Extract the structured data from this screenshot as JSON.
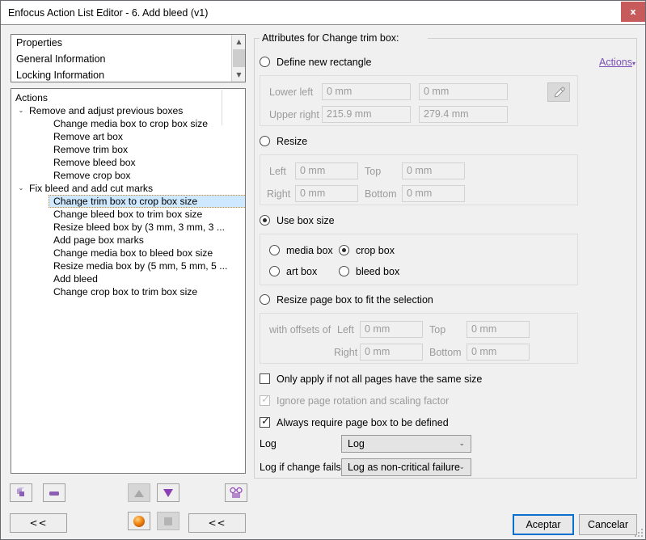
{
  "window": {
    "title": "Enfocus Action List Editor - 6. Add bleed (v1)",
    "close_label": "x"
  },
  "properties_list": {
    "items": [
      {
        "label": "Properties"
      },
      {
        "label": "General Information"
      },
      {
        "label": "Locking Information"
      }
    ]
  },
  "actions_tree": {
    "header": "Actions",
    "rows": [
      {
        "label": "Remove and adjust previous boxes",
        "type": "group",
        "expanded": true
      },
      {
        "label": "Change media box to crop box size",
        "type": "leaf"
      },
      {
        "label": "Remove art box",
        "type": "leaf"
      },
      {
        "label": "Remove trim box",
        "type": "leaf"
      },
      {
        "label": "Remove bleed box",
        "type": "leaf"
      },
      {
        "label": "Remove crop box",
        "type": "leaf"
      },
      {
        "label": "Fix bleed and add cut marks",
        "type": "group",
        "expanded": true
      },
      {
        "label": "Change trim box to crop box size",
        "type": "leaf",
        "selected": true
      },
      {
        "label": "Change bleed box to trim box size",
        "type": "leaf"
      },
      {
        "label": "Resize bleed box by (3 mm, 3 mm, 3 ...",
        "type": "leaf"
      },
      {
        "label": "Add page box marks",
        "type": "leaf"
      },
      {
        "label": "Change media box to bleed box size",
        "type": "leaf"
      },
      {
        "label": "Resize media box by (5 mm, 5 mm, 5 ...",
        "type": "leaf"
      },
      {
        "label": "Add bleed",
        "type": "leaf"
      },
      {
        "label": "Change crop box to trim box size",
        "type": "leaf"
      }
    ],
    "twisty_glyph": "⌄"
  },
  "left_toolbar": {
    "duplicate_action": "duplicate-action",
    "remove_action": "remove-action",
    "move_up": "move-up",
    "move_down": "move-down",
    "preview": "preview",
    "collapse_left_label": "<<",
    "collapse_right_label": "<<",
    "sphere_toggle": "sphere-toggle",
    "square_toggle": "square-toggle"
  },
  "attributes": {
    "legend": "Attributes for Change trim box:",
    "actions_link": "Actions",
    "actions_caret": "▾",
    "modes": {
      "define_new_rectangle": {
        "label": "Define new rectangle",
        "selected": false
      },
      "resize": {
        "label": "Resize",
        "selected": false
      },
      "use_box_size": {
        "label": "Use box size",
        "selected": true
      },
      "resize_page_box": {
        "label": "Resize page box to fit the selection",
        "selected": false
      }
    },
    "rectangle": {
      "lower_left_label": "Lower left",
      "lower_left_x": "0 mm",
      "lower_left_y": "0 mm",
      "upper_right_label": "Upper right",
      "upper_right_x": "215.9 mm",
      "upper_right_y": "279.4 mm",
      "picker": "eyedropper"
    },
    "resize_fields": {
      "left_label": "Left",
      "left_value": "0 mm",
      "top_label": "Top",
      "top_value": "0 mm",
      "right_label": "Right",
      "right_value": "0 mm",
      "bottom_label": "Bottom",
      "bottom_value": "0 mm"
    },
    "box_size": {
      "options": [
        {
          "label": "media box",
          "selected": false
        },
        {
          "label": "crop box",
          "selected": true
        },
        {
          "label": "art box",
          "selected": false
        },
        {
          "label": "bleed box",
          "selected": false
        }
      ]
    },
    "offsets": {
      "prefix_label": "with offsets of",
      "left_label": "Left",
      "left_value": "0 mm",
      "top_label": "Top",
      "top_value": "0 mm",
      "right_label": "Right",
      "right_value": "0 mm",
      "bottom_label": "Bottom",
      "bottom_value": "0 mm"
    },
    "checkboxes": [
      {
        "label": "Only apply if not all pages have the same size",
        "checked": false,
        "enabled": true
      },
      {
        "label": "Ignore page rotation and scaling factor",
        "checked": true,
        "enabled": false
      },
      {
        "label": "Always require page box to be defined",
        "checked": true,
        "enabled": true
      }
    ],
    "log": {
      "label": "Log",
      "value": "Log",
      "fail_label": "Log if change fails",
      "fail_value": "Log as non-critical failure",
      "caret": "⌄"
    }
  },
  "footer": {
    "ok_label": "Aceptar",
    "cancel_label": "Cancelar"
  }
}
